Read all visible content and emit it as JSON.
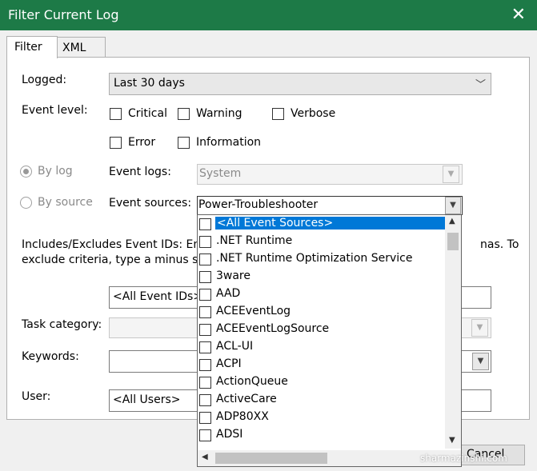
{
  "window": {
    "title": "Filter Current Log",
    "close_glyph": "✕"
  },
  "tabs": [
    {
      "label": "Filter"
    },
    {
      "label": "XML"
    }
  ],
  "form": {
    "logged_label": "Logged:",
    "logged_value": "Last 30 days",
    "event_level_label": "Event level:",
    "levels": [
      {
        "label": "Critical",
        "checked": false
      },
      {
        "label": "Warning",
        "checked": false
      },
      {
        "label": "Verbose",
        "checked": false
      },
      {
        "label": "Error",
        "checked": false
      },
      {
        "label": "Information",
        "checked": false
      }
    ],
    "by_log_label": "By log",
    "by_source_label": "By source",
    "event_logs_label": "Event logs:",
    "event_logs_value": "System",
    "event_sources_label": "Event sources:",
    "event_sources_value": "Power-Troubleshooter",
    "ids_desc_line1_left": "Includes/Excludes Event IDs: Ente",
    "ids_desc_line1_right": "nas. To",
    "ids_desc_line2_left": "exclude criteria, type a minus sig",
    "event_ids_value": "<All Event IDs>",
    "task_category_label": "Task category:",
    "keywords_label": "Keywords:",
    "user_label": "User:",
    "user_value": "<All Users>",
    "cancel_partial": "Cancel"
  },
  "sources_list": [
    {
      "label": "<All Event Sources>",
      "selected": true
    },
    {
      "label": ".NET Runtime"
    },
    {
      "label": ".NET Runtime Optimization Service"
    },
    {
      "label": "3ware"
    },
    {
      "label": "AAD"
    },
    {
      "label": "ACEEventLog"
    },
    {
      "label": "ACEEventLogSource"
    },
    {
      "label": "ACL-UI"
    },
    {
      "label": "ACPI"
    },
    {
      "label": "ActionQueue"
    },
    {
      "label": "ActiveCare"
    },
    {
      "label": "ADP80XX"
    },
    {
      "label": "ADSI"
    }
  ],
  "watermark": "sharmazinshi.com",
  "colors": {
    "titlebar": "#1d7a47",
    "selection": "#0078d7"
  }
}
